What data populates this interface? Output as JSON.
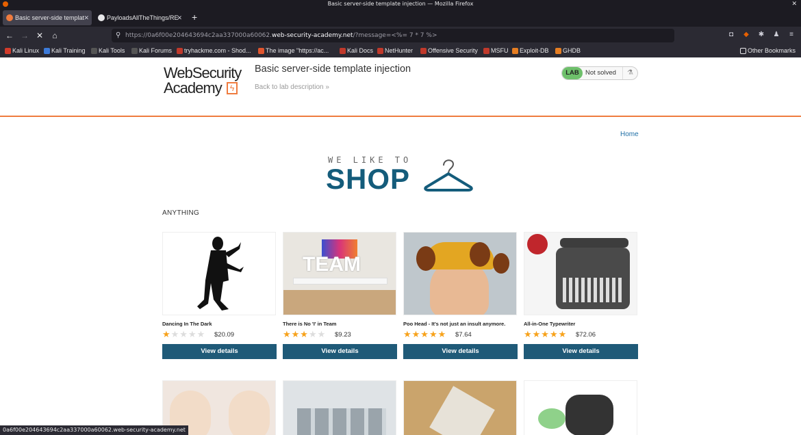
{
  "window": {
    "title": "Basic server-side template injection — Mozilla Firefox"
  },
  "tabs": [
    {
      "label": "Basic server-side templat"
    },
    {
      "label": "PayloadsAllTheThings/RE"
    }
  ],
  "url": {
    "prefix": "https://0a6f00e204643694c2aa337000a60062.",
    "domain": "web-security-academy.net",
    "suffix": "/?message=<%= 7 * 7 %>"
  },
  "bookmarks": [
    {
      "label": "Kali Linux",
      "color": "#d23b2b"
    },
    {
      "label": "Kali Training",
      "color": "#3d7bd9"
    },
    {
      "label": "Kali Tools",
      "color": "#555555"
    },
    {
      "label": "Kali Forums",
      "color": "#555555"
    },
    {
      "label": "tryhackme.com - Shod...",
      "color": "#c0392b"
    },
    {
      "label": "The image \"https://ac...",
      "color": "#e0552e"
    },
    {
      "label": "Kali Docs",
      "color": "#c0392b"
    },
    {
      "label": "NetHunter",
      "color": "#c0392b"
    },
    {
      "label": "Offensive Security",
      "color": "#c0392b"
    },
    {
      "label": "MSFU",
      "color": "#c0392b"
    },
    {
      "label": "Exploit-DB",
      "color": "#e67e22"
    },
    {
      "label": "GHDB",
      "color": "#e67e22"
    }
  ],
  "other_bookmarks": "Other Bookmarks",
  "header": {
    "logo_line1": "WebSecurity",
    "logo_line2": "Academy",
    "lab_title": "Basic server-side template injection",
    "back_link": "Back to lab description",
    "badge_label": "LAB",
    "badge_status": "Not solved"
  },
  "home_link": "Home",
  "shop_logo": {
    "top": "WE LIKE TO",
    "main": "SHOP"
  },
  "category": "ANYTHING",
  "products": [
    {
      "name": "Dancing In The Dark",
      "rating": 1,
      "price": "$20.09",
      "button": "View details"
    },
    {
      "name": "There is No 'I' in Team",
      "rating": 3,
      "price": "$9.23",
      "button": "View details"
    },
    {
      "name": "Poo Head - It's not just an insult anymore.",
      "rating": 5,
      "price": "$7.64",
      "button": "View details"
    },
    {
      "name": "All-in-One Typewriter",
      "rating": 5,
      "price": "$72.06",
      "button": "View details"
    }
  ],
  "status_bar": "0a6f00e204643694c2aa337000a60062.web-security-academy.net",
  "colors": {
    "accent": "#ef7b3e",
    "button": "#1f5a78",
    "star": "#f7a21b",
    "lab_green": "#6ec06b"
  }
}
